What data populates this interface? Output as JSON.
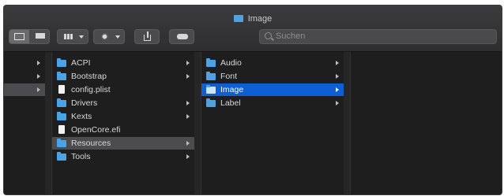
{
  "window": {
    "title": "Image",
    "title_icon": "folder-icon"
  },
  "toolbar": {
    "view_buttons": [
      "columns-view-icon",
      "gallery-view-icon"
    ],
    "group_button": "grid-group-icon",
    "action_button": "gear-icon",
    "share_button": "share-icon",
    "tag_button": "tag-icon",
    "search": {
      "placeholder": "Suchen",
      "icon": "search-icon"
    }
  },
  "columns": [
    {
      "name": "column-1",
      "items": [
        {
          "label": "",
          "type": "folder",
          "arrow": true
        },
        {
          "label": "",
          "type": "folder",
          "arrow": true
        },
        {
          "label": "",
          "type": "folder",
          "arrow": true,
          "selected": "gray"
        }
      ]
    },
    {
      "name": "column-2",
      "items": [
        {
          "label": "ACPI",
          "type": "folder",
          "arrow": true
        },
        {
          "label": "Bootstrap",
          "type": "folder",
          "arrow": true
        },
        {
          "label": "config.plist",
          "type": "file",
          "arrow": false
        },
        {
          "label": "Drivers",
          "type": "folder",
          "arrow": true
        },
        {
          "label": "Kexts",
          "type": "folder",
          "arrow": true
        },
        {
          "label": "OpenCore.efi",
          "type": "file",
          "arrow": false
        },
        {
          "label": "Resources",
          "type": "folder",
          "arrow": true,
          "selected": "gray"
        },
        {
          "label": "Tools",
          "type": "folder",
          "arrow": true
        }
      ]
    },
    {
      "name": "column-3",
      "items": [
        {
          "label": "Audio",
          "type": "folder",
          "arrow": true
        },
        {
          "label": "Font",
          "type": "folder",
          "arrow": true
        },
        {
          "label": "Image",
          "type": "folder",
          "arrow": true,
          "selected": "blue"
        },
        {
          "label": "Label",
          "type": "folder",
          "arrow": true
        }
      ]
    }
  ],
  "colors": {
    "folder": "#4aa3e6",
    "selection_active": "#0e5fd6",
    "selection_inactive": "#4c4c4e"
  }
}
